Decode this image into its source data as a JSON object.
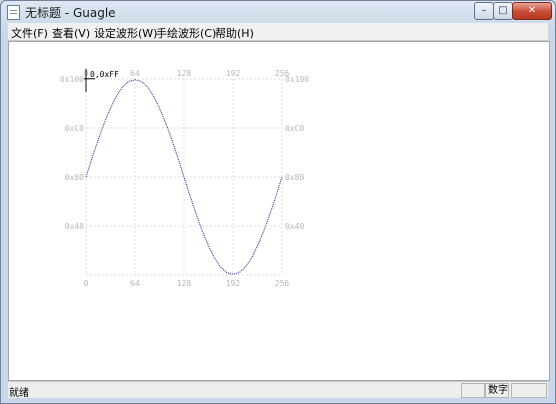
{
  "window": {
    "title": "无标题 - Guagle"
  },
  "menu": [
    "文件(F)",
    "查看(V)",
    "设定波形(W)",
    "手绘波形(C)",
    "帮助(H)"
  ],
  "chart_data": {
    "type": "line",
    "title": "",
    "xlabel": "",
    "ylabel": "",
    "xlim": [
      0,
      256
    ],
    "ylim": [
      0,
      256
    ],
    "x_ticks": [
      {
        "value": 0,
        "label": "0"
      },
      {
        "value": 64,
        "label": "64"
      },
      {
        "value": 128,
        "label": "128"
      },
      {
        "value": 192,
        "label": "192"
      },
      {
        "value": 256,
        "label": "256"
      }
    ],
    "y_ticks": [
      {
        "value": 256,
        "label": "0x100"
      },
      {
        "value": 192,
        "label": "0xC0"
      },
      {
        "value": 128,
        "label": "0x80"
      },
      {
        "value": 64,
        "label": "0x40"
      }
    ],
    "grid": true,
    "line_color": "#1c1c8c",
    "series": [
      {
        "name": "",
        "x": [
          0,
          8,
          16,
          24,
          32,
          40,
          48,
          56,
          64,
          72,
          80,
          88,
          96,
          104,
          112,
          120,
          128,
          136,
          144,
          152,
          160,
          168,
          176,
          184,
          192,
          200,
          208,
          216,
          224,
          232,
          240,
          248,
          256
        ],
        "values": [
          128,
          153,
          177,
          199,
          218,
          234,
          246,
          253,
          255,
          253,
          246,
          234,
          218,
          199,
          177,
          153,
          128,
          103,
          79,
          57,
          38,
          22,
          10,
          3,
          1,
          3,
          10,
          22,
          38,
          57,
          79,
          103,
          128
        ]
      }
    ],
    "cursor": {
      "label": "0,0xFF",
      "x": 0,
      "y": 255
    }
  },
  "status": {
    "text": "就绪",
    "panels": [
      "",
      "数字",
      ""
    ]
  }
}
